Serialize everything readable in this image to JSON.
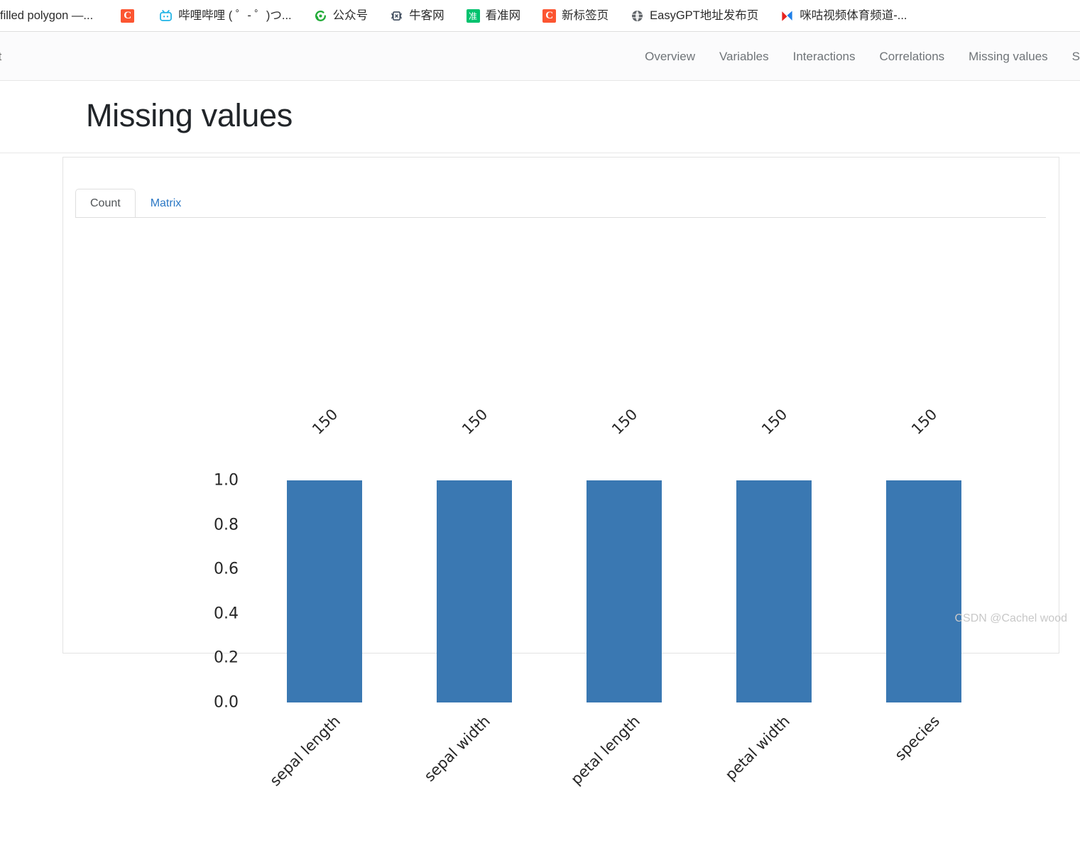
{
  "browser": {
    "bookmarks": [
      {
        "label": "filled polygon —...",
        "icon": "text-only-icon",
        "icon_type": "none"
      },
      {
        "label": "",
        "icon": "csdn-icon",
        "icon_type": "csdn"
      },
      {
        "label": "哔哩哔哩 ( ゜- ゜)つ...",
        "icon": "bilibili-icon",
        "icon_type": "bilibili"
      },
      {
        "label": "公众号",
        "icon": "wechat-mp-icon",
        "icon_type": "wechat"
      },
      {
        "label": "牛客网",
        "icon": "nowcoder-icon",
        "icon_type": "nowcoder"
      },
      {
        "label": "看准网",
        "icon": "kanzhun-icon",
        "icon_type": "kanzhun",
        "icon_text": "准"
      },
      {
        "label": "新标签页",
        "icon": "csdn-icon",
        "icon_type": "csdn"
      },
      {
        "label": "EasyGPT地址发布页",
        "icon": "globe-icon",
        "icon_type": "globe"
      },
      {
        "label": "咪咕视频体育频道-...",
        "icon": "migu-icon",
        "icon_type": "migu"
      }
    ]
  },
  "site_nav": {
    "brand": "rt",
    "links": [
      {
        "label": "Overview"
      },
      {
        "label": "Variables"
      },
      {
        "label": "Interactions"
      },
      {
        "label": "Correlations"
      },
      {
        "label": "Missing values"
      },
      {
        "label": "S"
      }
    ]
  },
  "main": {
    "page_title": "Missing values",
    "tabs": [
      {
        "label": "Count",
        "active": true
      },
      {
        "label": "Matrix",
        "active": false
      }
    ]
  },
  "watermark": "CSDN @Cachel wood",
  "colors": {
    "bar": "#3a78b2",
    "link": "#2a77c4",
    "nav_text": "#6f7478",
    "title": "#212529"
  },
  "chart_data": {
    "type": "bar",
    "title": "",
    "xlabel": "",
    "ylabel": "",
    "categories": [
      "sepal length",
      "sepal width",
      "petal length",
      "petal width",
      "species"
    ],
    "values": [
      1.0,
      1.0,
      1.0,
      1.0,
      1.0
    ],
    "data_labels": [
      "150",
      "150",
      "150",
      "150",
      "150"
    ],
    "counts": [
      150,
      150,
      150,
      150,
      150
    ],
    "ylim": [
      0.0,
      1.0
    ],
    "yticks": [
      "0.0",
      "0.2",
      "0.4",
      "0.6",
      "0.8",
      "1.0"
    ],
    "ytick_values": [
      0.0,
      0.2,
      0.4,
      0.6,
      0.8,
      1.0
    ],
    "grid": false,
    "legend": false,
    "bar_color": "#3a78b2",
    "xtick_rotation": -45,
    "label_rotation": -45
  }
}
